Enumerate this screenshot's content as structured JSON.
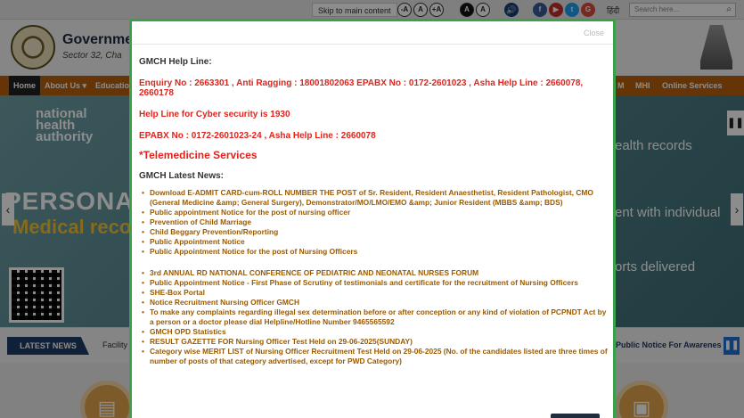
{
  "topbar": {
    "skip_label": "Skip to main content",
    "font_buttons": [
      "-A",
      "A",
      "+A"
    ],
    "contrast_buttons": [
      "A",
      "A"
    ],
    "hindi_label": "हिंदी",
    "search_placeholder": "Search here..."
  },
  "header": {
    "title": "Governme",
    "subtitle": "Sector 32, Cha"
  },
  "nav": {
    "items": [
      "Home",
      "About Us ▾",
      "Education",
      "M",
      "MHI",
      "Online Services"
    ]
  },
  "banner": {
    "nha_line1": "national",
    "nha_line2": "health",
    "nha_line3": "authority",
    "personal": "PERSONAL H",
    "medical": "Medical recor",
    "right_texts": [
      "ealth records",
      "ent with individual",
      "orts delivered"
    ]
  },
  "ticker": {
    "latest_label": "LATEST NEWS",
    "left_text": "Facility",
    "right_text": "Public Notice For Awarenes"
  },
  "modal": {
    "close_label": "Close",
    "helpline_heading": "GMCH Help Line:",
    "enquiry": "Enquiry No : 2663301  , Anti Ragging : 18001802063  EPABX No : 0172-2601023 , Asha Help Line : 2660078, 2660178",
    "cyber": "Help Line for Cyber security is 1930",
    "epabx": "EPABX No : 0172-2601023-24 , Asha Help Line : 2660078",
    "telemedicine": "*Telemedicine Services",
    "news_heading": "GMCH Latest News:",
    "news_group1": [
      "Download E-ADMIT CARD-cum-ROLL NUMBER THE POST of Sr. Resident, Resident Anaesthetist, Resident Pathologist, CMO (General Medicine &amp; General Surgery), Demonstrator/MO/LMO/EMO &amp; Junior Resident (MBBS &amp; BDS)",
      "Public appointment Notice for the post of nursing officer",
      "Prevention of Child Marriage",
      "Child Beggary Prevention/Reporting",
      "Public Appointment Notice",
      "Public Appointment Notice for the post of Nursing Officers"
    ],
    "news_group2": [
      "3rd ANNUAL RD NATIONAL CONFERENCE OF PEDIATRIC AND NEONATAL NURSES FORUM",
      "Public Appointment Notice - First Phase of Scrutiny of testimonials and certificate for the recruitment of Nursing Officers",
      "SHE-Box Portal",
      "Notice Recruitment Nursing Officer GMCH",
      "To make any complaints regarding illegal sex determination before or after conception or any kind of violation of PCPNDT Act by a person or a doctor please dial Helpline/Hotline Number 9465565592",
      "GMCH OPD Statistics",
      "RESULT GAZETTE FOR Nursing Officer Test Held on 29-06-2025(SUNDAY)",
      "Category wise MERIT LIST of Nursing Officer Recruitment Test Held on 29-06-2025 (No. of the candidates listed are three times of number of posts of that category advertised, except for PWD Category)"
    ]
  }
}
